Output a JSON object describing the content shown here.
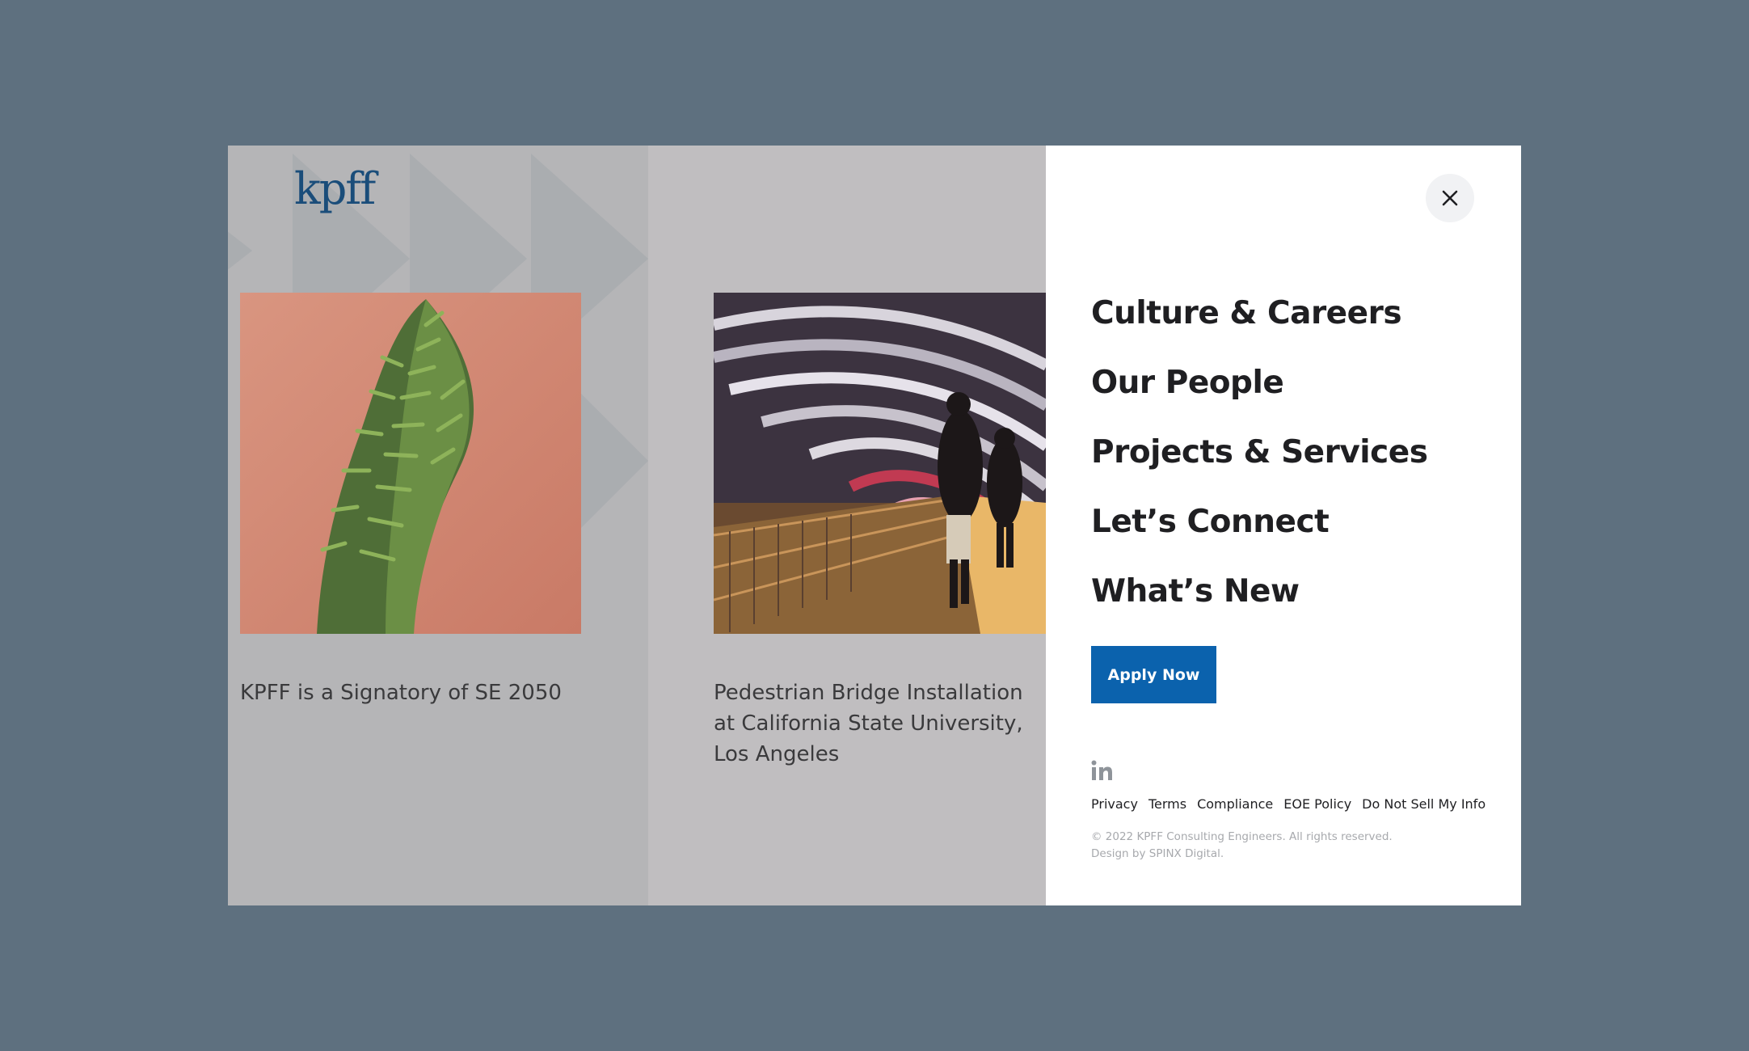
{
  "brand": {
    "logo_text": "kpff",
    "logo_color": "#1a4d7a"
  },
  "cards": [
    {
      "title": "KPFF is a Signatory of SE 2050"
    },
    {
      "title": "Pedestrian Bridge Installation at California State University, Los Angeles"
    }
  ],
  "menu": {
    "close_icon": "close-icon",
    "items": [
      {
        "label": "Culture & Careers"
      },
      {
        "label": "Our People"
      },
      {
        "label": "Projects & Services"
      },
      {
        "label": "Let’s Connect"
      },
      {
        "label": "What’s New"
      }
    ],
    "cta_label": "Apply Now",
    "cta_color": "#0b62ad",
    "social_icon": "linkedin-icon",
    "footer_links": [
      {
        "label": "Privacy"
      },
      {
        "label": "Terms"
      },
      {
        "label": "Compliance"
      },
      {
        "label": "EOE Policy"
      },
      {
        "label": "Do Not Sell My Info"
      }
    ],
    "copyright": "© 2022 KPFF Consulting Engineers. All rights reserved.",
    "design_credit": "Design by SPINX Digital."
  }
}
